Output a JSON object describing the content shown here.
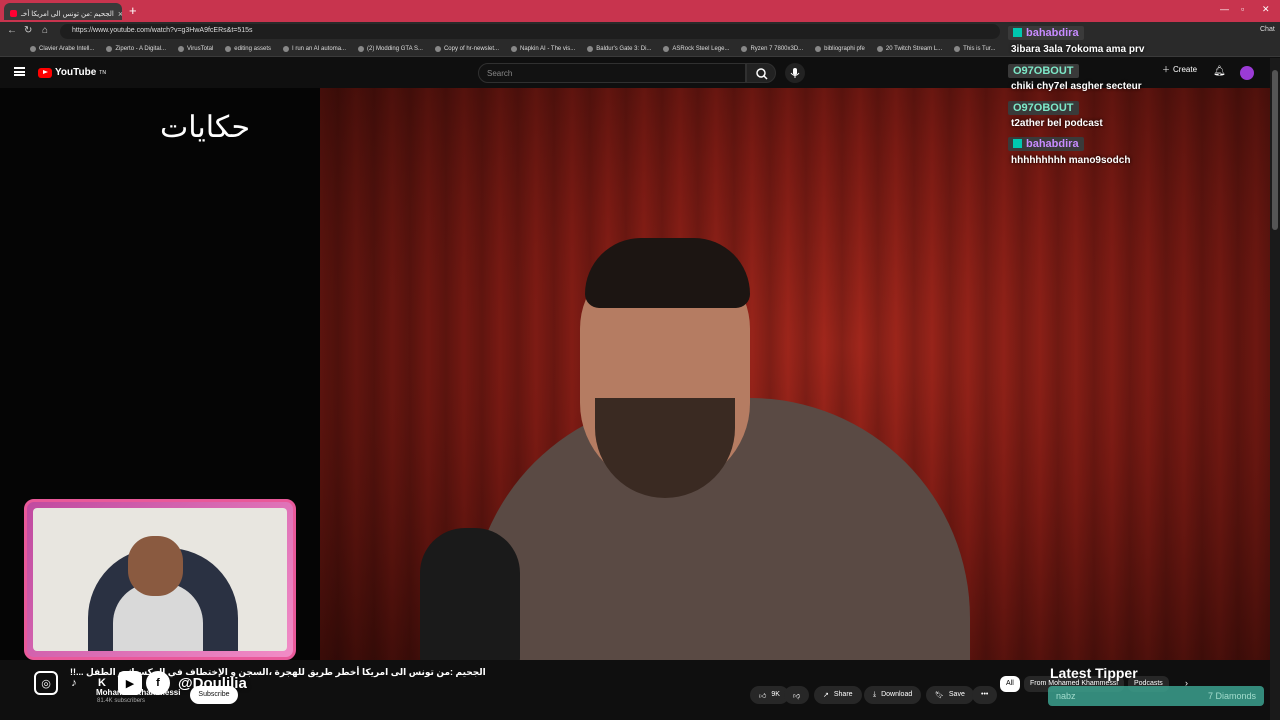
{
  "browser": {
    "tab_title": "الجحيم :من تونس الى امريكا أخـ",
    "url": "https://www.youtube.com/watch?v=g3HwA9fcERs&t=515s",
    "bookmarks": [
      "Clavier Arabe Intell...",
      "Ziperto - A Digital...",
      "VirusTotal",
      "editing assets",
      "I run an AI automa...",
      "(2) Modding GTA S...",
      "Copy of hr-newslet...",
      "Napkin AI - The vis...",
      "Baldur's Gate 3: Di...",
      "ASRock Steel Lege...",
      "Ryzen 7 7800x3D...",
      "bibliographi pfe",
      "20 Twitch Stream L...",
      "This is Tur..."
    ],
    "chat_label": "Chat"
  },
  "youtube": {
    "logo": "YouTube",
    "logo_sup": "TN",
    "search_placeholder": "Search",
    "create_label": "Create"
  },
  "video": {
    "overlay_logo": "حكايات",
    "title": "الجحيم :من تونس الى امريكا أخطر طريق للهجرة ،السجن و الإختطاف في المكسيك و الطفل ...!!",
    "channel": "Mohamed Khammessi",
    "subscribers": "81.4K subscribers",
    "subscribe_label": "Subscribe",
    "likes": "9K",
    "share_label": "Share",
    "download_label": "Download",
    "save_label": "Save"
  },
  "chat": [
    {
      "user": "bahabdira",
      "badge": true,
      "text": "3ibara 3ala 7okoma ama prv"
    },
    {
      "user": "O97OBOUT",
      "badge": false,
      "text": "chiki chy7el asgher secteur"
    },
    {
      "user": "O97OBOUT",
      "badge": false,
      "text": "t2ather bel podcast"
    },
    {
      "user": "bahabdira",
      "badge": true,
      "text": "hhhhhhhhh mano9sodch"
    }
  ],
  "stream_overlay": {
    "handle": "@Doulilia",
    "latest_tipper_label": "Latest Tipper",
    "tipper_name": "nabz",
    "tipper_amount": "7 Diamonds"
  },
  "filters": {
    "all_label": "All",
    "from_label": "From Mohamed Khammessi",
    "podcasts_label": "Podcasts"
  }
}
